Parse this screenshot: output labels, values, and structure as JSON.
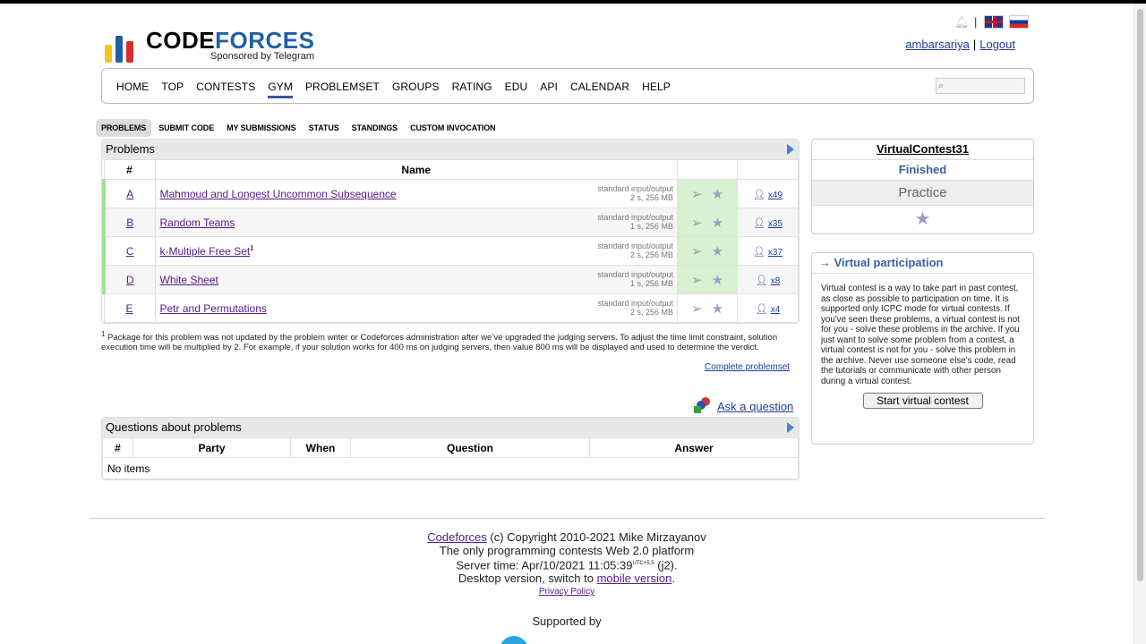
{
  "header": {
    "logo_code": "CODE",
    "logo_forces": "FORCES",
    "sponsored": "Sponsored by Telegram",
    "username": "ambarsariya",
    "logout": "Logout",
    "separator": "|"
  },
  "menu": [
    "HOME",
    "TOP",
    "CONTESTS",
    "GYM",
    "PROBLEMSET",
    "GROUPS",
    "RATING",
    "EDU",
    "API",
    "CALENDAR",
    "HELP"
  ],
  "subtabs": [
    "PROBLEMS",
    "SUBMIT CODE",
    "MY SUBMISSIONS",
    "STATUS",
    "STANDINGS",
    "CUSTOM INVOCATION"
  ],
  "problems": {
    "title": "Problems",
    "col_num": "#",
    "col_name": "Name",
    "rows": [
      {
        "id": "A",
        "name": "Mahmoud and Longest Uncommon Subsequence",
        "sup": "",
        "io": "standard input/output",
        "limits": "2 s, 256 MB",
        "solved": "x49"
      },
      {
        "id": "B",
        "name": "Random Teams",
        "sup": "",
        "io": "standard input/output",
        "limits": "1 s, 256 MB",
        "solved": "x35"
      },
      {
        "id": "C",
        "name": "k-Multiple Free Set",
        "sup": "1",
        "io": "standard input/output",
        "limits": "2 s, 256 MB",
        "solved": "x37"
      },
      {
        "id": "D",
        "name": "White Sheet",
        "sup": "",
        "io": "standard input/output",
        "limits": "1 s, 256 MB",
        "solved": "x8"
      },
      {
        "id": "E",
        "name": "Petr and Permutations",
        "sup": "",
        "io": "standard input/output",
        "limits": "2 s, 256 MB",
        "solved": "x4"
      }
    ]
  },
  "footnote": {
    "marker": "1",
    "text": " Package for this problem was not updated by the problem writer or Codeforces administration after we’ve upgraded the judging servers. To adjust the time limit constraint, solution execution time will be multiplied by 2. For example, if your solution works for 400 ms on judging servers, then value 800 ms will be displayed and used to determine the verdict."
  },
  "complete_problemset": "Complete problemset",
  "ask_question": "Ask a question",
  "questions": {
    "title": "Questions about problems",
    "headers": [
      "#",
      "Party",
      "When",
      "Question",
      "Answer"
    ],
    "empty": "No items"
  },
  "sidebar": {
    "contest_name": "VirtualContest31",
    "status": "Finished",
    "practice": "Practice",
    "vp_title": "→ Virtual participation",
    "vp_text": "Virtual contest is a way to take part in past contest, as close as possible to participation on time. It is supported only ICPC mode for virtual contests. If you've seen these problems, a virtual contest is not for you - solve these problems in the archive. If you just want to solve some problem from a contest, a virtual contest is not for you - solve this problem in the archive. Never use someone else's code, read the tutorials or communicate with other person during a virtual contest.",
    "vp_button": "Start virtual contest"
  },
  "footer": {
    "codeforces": "Codeforces",
    "copyright": " (c) Copyright 2010-2021 Mike Mirzayanov",
    "platform": "The only programming contests Web 2.0 platform",
    "server_time_prefix": "Server time: Apr/10/2021 11:05:39",
    "utc": "UTC+5.5",
    "server_suffix": " (j2).",
    "desktop_prefix": "Desktop version, switch to ",
    "mobile": "mobile version",
    "desktop_suffix": ".",
    "privacy": "Privacy Policy",
    "supported_by": "Supported by"
  },
  "colors": {
    "accent": "#3b5998",
    "accepted_green": "#a0e29a",
    "link": "#551a8b"
  }
}
